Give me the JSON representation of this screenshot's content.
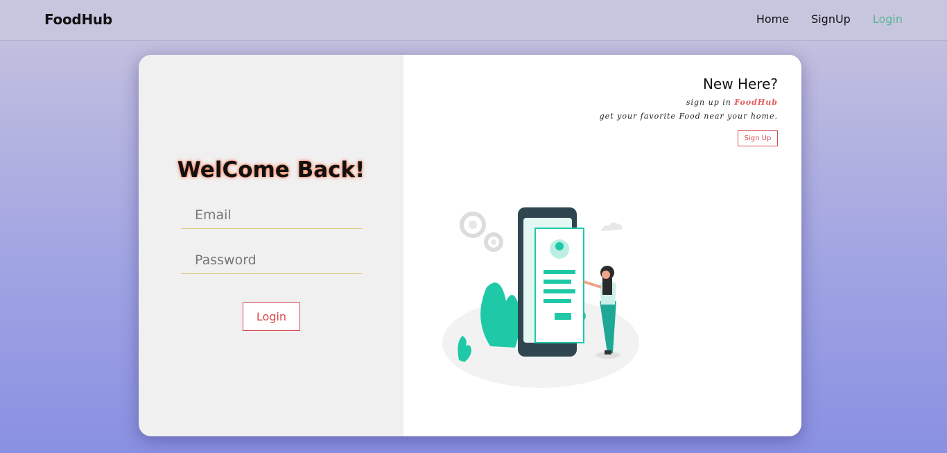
{
  "nav": {
    "brand": "FoodHub",
    "links": [
      "Home",
      "SignUp",
      "Login"
    ],
    "active_color": "#5cb590"
  },
  "login": {
    "title": "WelCome Back!",
    "email_placeholder": "Email",
    "password_placeholder": "Password",
    "button_label": "Login"
  },
  "signup_panel": {
    "heading": "New Here?",
    "tagline_prefix": "sign up in",
    "tagline_brand": "FoodHub",
    "tagline_line2": "get your favorite Food near your home.",
    "button_label": "Sign Up"
  },
  "illustration": {
    "icon": "mobile-login-illustration",
    "accent_color": "#1fc9a8"
  }
}
